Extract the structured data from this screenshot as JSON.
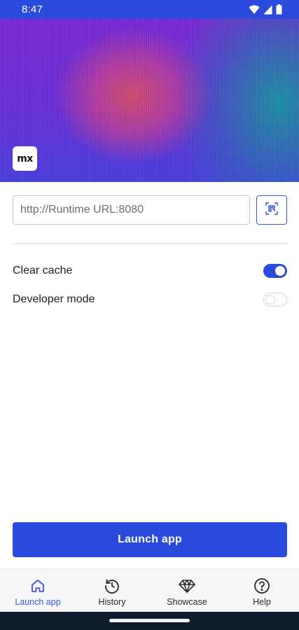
{
  "status_bar": {
    "time": "8:47",
    "icons": [
      "wifi-icon",
      "signal-icon",
      "battery-icon"
    ]
  },
  "hero": {
    "logo_text": "mx"
  },
  "url_field": {
    "placeholder": "http://Runtime URL:8080",
    "value": ""
  },
  "qr_button": {
    "icon": "qr-scan-icon"
  },
  "settings": {
    "clear_cache": {
      "label": "Clear cache",
      "enabled": true
    },
    "developer_mode": {
      "label": "Developer mode",
      "enabled": false
    }
  },
  "launch_button": {
    "label": "Launch app"
  },
  "bottom_nav": {
    "items": [
      {
        "label": "Launch app",
        "icon": "home-icon",
        "active": true
      },
      {
        "label": "History",
        "icon": "history-icon",
        "active": false
      },
      {
        "label": "Showcase",
        "icon": "diamond-icon",
        "active": false
      },
      {
        "label": "Help",
        "icon": "help-icon",
        "active": false
      }
    ]
  },
  "colors": {
    "accent": "#2b4bdc",
    "nav_active": "#3a57e8",
    "nav_background": "#f6f6f7"
  }
}
